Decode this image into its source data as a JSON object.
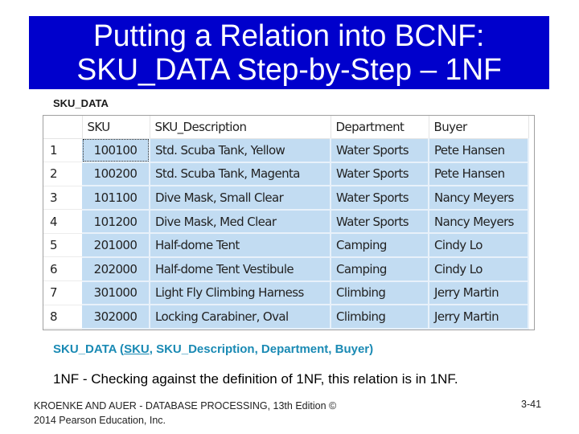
{
  "slide": {
    "title_line1": "Putting a Relation into BCNF:",
    "title_line2": "SKU_DATA Step-by-Step – 1NF",
    "banner_color": "#0000cc"
  },
  "table": {
    "caption": "SKU_DATA",
    "columns": [
      "",
      "SKU",
      "SKU_Description",
      "Department",
      "Buyer"
    ],
    "rows": [
      {
        "num": "1",
        "sku": "100100",
        "description": "Std. Scuba Tank, Yellow",
        "department": "Water Sports",
        "buyer": "Pete Hansen"
      },
      {
        "num": "2",
        "sku": "100200",
        "description": "Std. Scuba Tank, Magenta",
        "department": "Water Sports",
        "buyer": "Pete Hansen"
      },
      {
        "num": "3",
        "sku": "101100",
        "description": "Dive Mask, Small Clear",
        "department": "Water Sports",
        "buyer": "Nancy Meyers"
      },
      {
        "num": "4",
        "sku": "101200",
        "description": "Dive Mask, Med Clear",
        "department": "Water Sports",
        "buyer": "Nancy Meyers"
      },
      {
        "num": "5",
        "sku": "201000",
        "description": "Half-dome Tent",
        "department": "Camping",
        "buyer": "Cindy Lo"
      },
      {
        "num": "6",
        "sku": "202000",
        "description": "Half-dome Tent Vestibule",
        "department": "Camping",
        "buyer": "Cindy Lo"
      },
      {
        "num": "7",
        "sku": "301000",
        "description": "Light Fly Climbing Harness",
        "department": "Climbing",
        "buyer": "Jerry Martin"
      },
      {
        "num": "8",
        "sku": "302000",
        "description": "Locking Carabiner, Oval",
        "department": "Climbing",
        "buyer": "Jerry Martin"
      }
    ],
    "selected_cell": {
      "row": 1,
      "column": "SKU"
    }
  },
  "relation": {
    "prefix": "SKU_DATA (",
    "primary_key": "SKU",
    "rest": ", SKU_Description, Department, Buyer)",
    "color": "#1a8ab4"
  },
  "statement": "1NF - Checking against the definition of 1NF, this relation is in 1NF.",
  "footer": {
    "line1": "KROENKE AND AUER - DATABASE PROCESSING, 13th Edition ©",
    "line2": "2014 Pearson Education, Inc.",
    "page": "3-41"
  }
}
